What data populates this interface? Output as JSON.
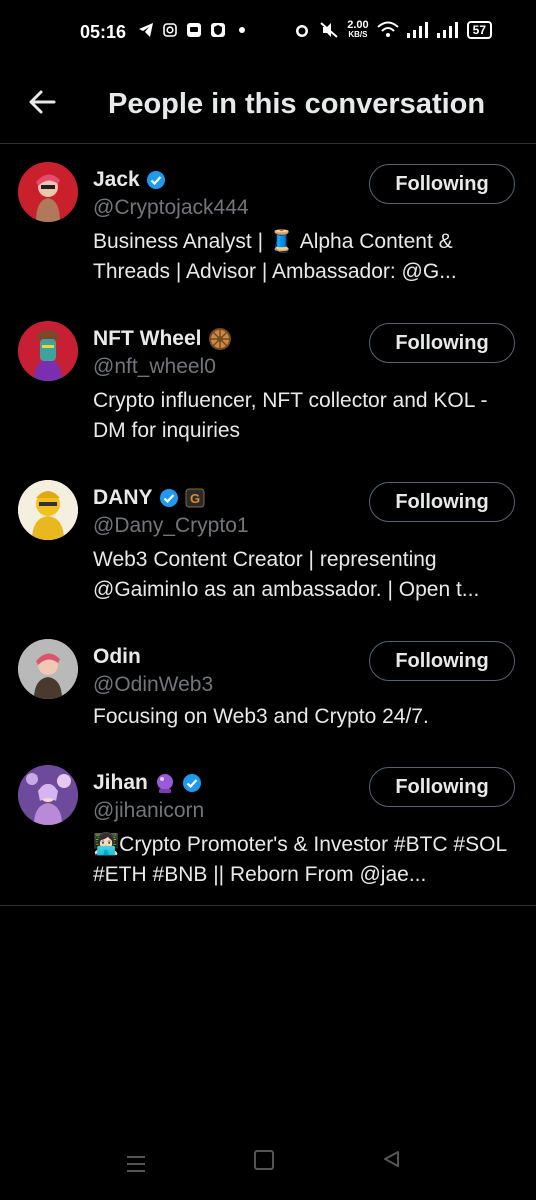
{
  "status_bar": {
    "time": "05:16",
    "net_speed_top": "2.00",
    "net_speed_unit": "KB/S",
    "battery": "57"
  },
  "header": {
    "title": "People in this conversation"
  },
  "people": [
    {
      "name": "Jack",
      "handle": "@Cryptojack444",
      "bio": "Business Analyst | 🧵 Alpha Content & Threads |  Advisor |  Ambassador: @G...",
      "button": "Following",
      "verified": true
    },
    {
      "name": "NFT Wheel",
      "handle": "@nft_wheel0",
      "bio": "Crypto influencer, NFT collector and KOL - DM for inquiries",
      "button": "Following",
      "verified": false
    },
    {
      "name": "DANY",
      "handle": "@Dany_Crypto1",
      "bio": "Web3 Content Creator | representing @GaiminIo as an ambassador. | Open t...",
      "button": "Following",
      "verified": true
    },
    {
      "name": "Odin",
      "handle": "@OdinWeb3",
      "bio": "Focusing on Web3 and Crypto 24/7.",
      "button": "Following",
      "verified": false
    },
    {
      "name": "Jihan",
      "handle": "@jihanicorn",
      "bio": "👩🏻‍💻Crypto Promoter's & Investor #BTC #SOL #ETH #BNB || Reborn From @jae...",
      "button": "Following",
      "verified": true
    }
  ],
  "colors": {
    "background": "#000000",
    "text": "#e7e9ea",
    "secondary": "#71767b",
    "verified": "#1d9bf0",
    "border": "#2f3336"
  }
}
